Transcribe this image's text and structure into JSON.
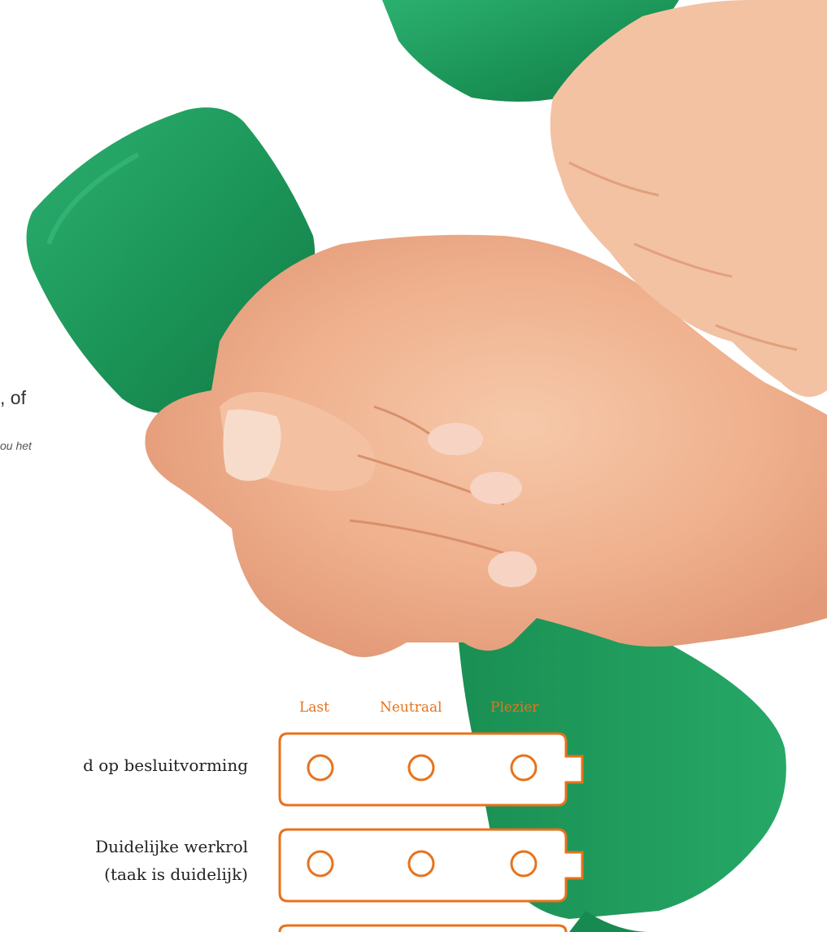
{
  "fragment": {
    "heading_tail": ", of",
    "note_tail": "ou het"
  },
  "scale": {
    "columns": [
      "Last",
      "Neutraal",
      "Plezier"
    ]
  },
  "rows": [
    {
      "label_lines": [
        "d op besluitvorming"
      ]
    },
    {
      "label_lines": [
        "Duidelijke werkrol",
        "(taak is duidelijk)"
      ]
    }
  ],
  "colors": {
    "accent": "#e8721c",
    "dumbbell": "#1f9a5c",
    "skin": "#f2b896"
  }
}
